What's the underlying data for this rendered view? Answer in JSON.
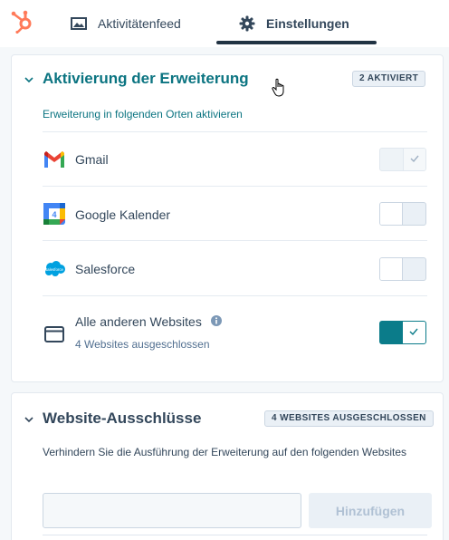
{
  "nav": {
    "logo": "hubspot-logo",
    "tabs": [
      {
        "label": "Aktivitätenfeed",
        "icon": "activity-feed-icon",
        "active": false
      },
      {
        "label": "Einstellungen",
        "icon": "gear-icon",
        "active": true
      }
    ]
  },
  "activation": {
    "title": "Aktivierung der Erweiterung",
    "badge": "2 AKTIVIERT",
    "subtitle": "Erweiterung in folgenden Orten aktivieren",
    "items": [
      {
        "label": "Gmail",
        "icon": "gmail-icon",
        "state": "on-disabled"
      },
      {
        "label": "Google Kalender",
        "icon": "google-calendar-icon",
        "state": "off"
      },
      {
        "label": "Salesforce",
        "icon": "salesforce-icon",
        "state": "off"
      },
      {
        "label": "Alle anderen Websites",
        "icon": "browser-window-icon",
        "state": "on",
        "sub": "4 Websites ausgeschlossen"
      }
    ]
  },
  "exclusions": {
    "title": "Website-Ausschlüsse",
    "badge": "4 WEBSITES AUSGESCHLOSSEN",
    "description": "Verhindern Sie die Ausführung der Erweiterung auf den folgenden Websites",
    "input_value": "",
    "add_label": "Hinzufügen"
  },
  "colors": {
    "accent": "#0b7c8a",
    "teal_text": "#0b7481",
    "text": "#33475b",
    "hubspot_orange": "#ff7a59"
  }
}
